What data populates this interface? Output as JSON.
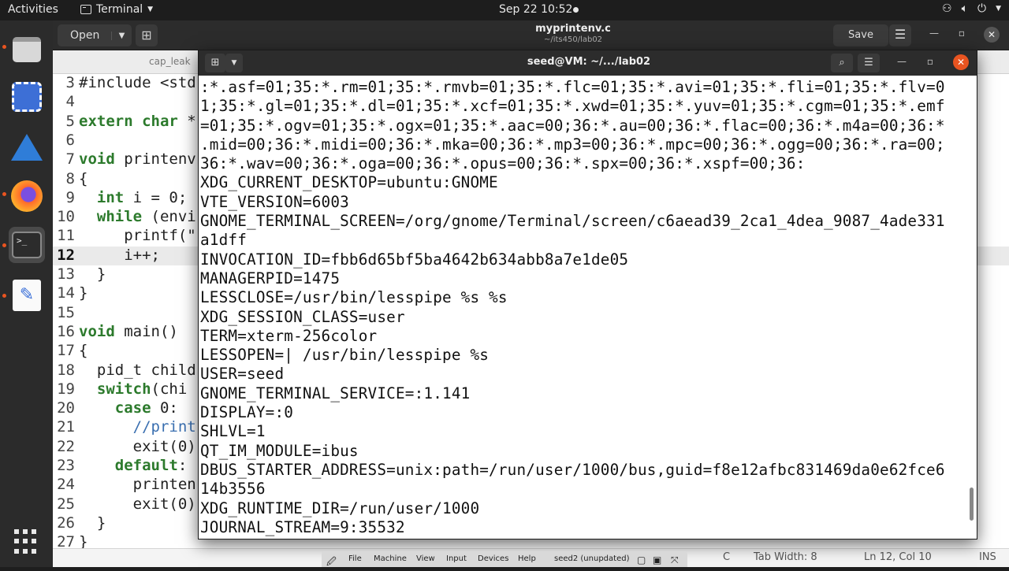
{
  "topbar": {
    "activities": "Activities",
    "app_name": "Terminal",
    "clock": "Sep 22  10:52"
  },
  "gedit": {
    "open_label": "Open",
    "title": "myprintenv.c",
    "subtitle": "~/its450/lab02",
    "save_label": "Save",
    "tab_label": "cap_leak",
    "code_lines": [
      {
        "n": "3",
        "text": "#include <std"
      },
      {
        "n": "4",
        "text": ""
      },
      {
        "n": "5",
        "text": "extern char *"
      },
      {
        "n": "6",
        "text": ""
      },
      {
        "n": "7",
        "text": "void printenv"
      },
      {
        "n": "8",
        "text": "{"
      },
      {
        "n": "9",
        "text": "  int i = 0;"
      },
      {
        "n": "10",
        "text": "  while (envi"
      },
      {
        "n": "11",
        "text": "     printf(\""
      },
      {
        "n": "12",
        "text": "     i++;"
      },
      {
        "n": "13",
        "text": "  }"
      },
      {
        "n": "14",
        "text": "}"
      },
      {
        "n": "15",
        "text": ""
      },
      {
        "n": "16",
        "text": "void main()"
      },
      {
        "n": "17",
        "text": "{"
      },
      {
        "n": "18",
        "text": "  pid_t child"
      },
      {
        "n": "19",
        "text": "  switch(chi"
      },
      {
        "n": "20",
        "text": "    case 0:"
      },
      {
        "n": "21",
        "text": "      //print"
      },
      {
        "n": "22",
        "text": "      exit(0)"
      },
      {
        "n": "23",
        "text": "    default:"
      },
      {
        "n": "24",
        "text": "      printen"
      },
      {
        "n": "25",
        "text": "      exit(0)"
      },
      {
        "n": "26",
        "text": "  }"
      },
      {
        "n": "27",
        "text": "}"
      }
    ],
    "status": {
      "lang": "C",
      "tab_width": "Tab Width: 8",
      "position": "Ln 12, Col 10",
      "mode": "INS"
    }
  },
  "terminal": {
    "title": "seed@VM: ~/.../lab02",
    "output_lines": [
      ":*.asf=01;35:*.rm=01;35:*.rmvb=01;35:*.flc=01;35:*.avi=01;35:*.fli=01;35:*.flv=0",
      "1;35:*.gl=01;35:*.dl=01;35:*.xcf=01;35:*.xwd=01;35:*.yuv=01;35:*.cgm=01;35:*.emf",
      "=01;35:*.ogv=01;35:*.ogx=01;35:*.aac=00;36:*.au=00;36:*.flac=00;36:*.m4a=00;36:*",
      ".mid=00;36:*.midi=00;36:*.mka=00;36:*.mp3=00;36:*.mpc=00;36:*.ogg=00;36:*.ra=00;",
      "36:*.wav=00;36:*.oga=00;36:*.opus=00;36:*.spx=00;36:*.xspf=00;36:",
      "XDG_CURRENT_DESKTOP=ubuntu:GNOME",
      "VTE_VERSION=6003",
      "GNOME_TERMINAL_SCREEN=/org/gnome/Terminal/screen/c6aead39_2ca1_4dea_9087_4ade331",
      "a1dff",
      "INVOCATION_ID=fbb6d65bf5ba4642b634abb8a7e1de05",
      "MANAGERPID=1475",
      "LESSCLOSE=/usr/bin/lesspipe %s %s",
      "XDG_SESSION_CLASS=user",
      "TERM=xterm-256color",
      "LESSOPEN=| /usr/bin/lesspipe %s",
      "USER=seed",
      "GNOME_TERMINAL_SERVICE=:1.141",
      "DISPLAY=:0",
      "SHLVL=1",
      "QT_IM_MODULE=ibus",
      "DBUS_STARTER_ADDRESS=unix:path=/run/user/1000/bus,guid=f8e12afbc831469da0e62fce6",
      "14b3556",
      "XDG_RUNTIME_DIR=/run/user/1000",
      "JOURNAL_STREAM=9:35532"
    ]
  },
  "vbox": {
    "menu": [
      "File",
      "Machine",
      "View",
      "Input",
      "Devices",
      "Help"
    ],
    "status": "seed2 (unupdated)"
  }
}
